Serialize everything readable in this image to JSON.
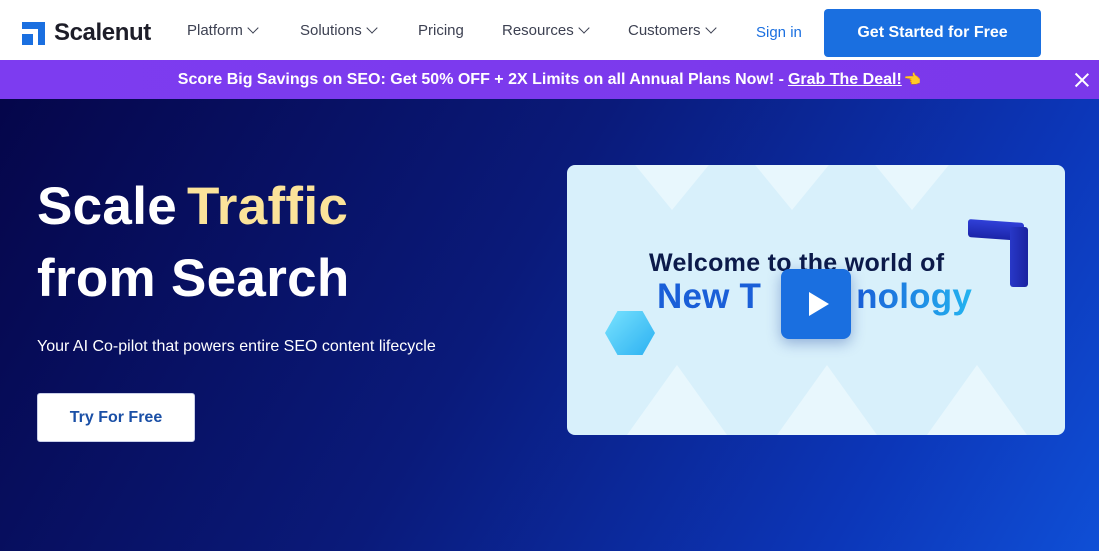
{
  "brand": {
    "name": "Scalenut",
    "color": "#1a6fe0"
  },
  "nav": {
    "items": [
      {
        "label": "Platform",
        "dropdown": true
      },
      {
        "label": "Solutions",
        "dropdown": true
      },
      {
        "label": "Pricing",
        "dropdown": false
      },
      {
        "label": "Resources",
        "dropdown": true
      },
      {
        "label": "Customers",
        "dropdown": true
      }
    ],
    "signin_label": "Sign in",
    "cta_label": "Get Started for Free"
  },
  "promo": {
    "text": "Score Big Savings on SEO: Get 50% OFF + 2X Limits on all Annual Plans Now! -",
    "link_label": "Grab The Deal!",
    "hand_icon": "👈",
    "close_icon": "close-icon",
    "background": "#7c3aed"
  },
  "hero": {
    "headline_part1": "Scale",
    "headline_highlight": "Traffic",
    "headline_line2": "from Search",
    "subtitle": "Your AI Co-pilot that powers entire SEO content lifecycle",
    "button_label": "Try For Free",
    "highlight_color": "#fbe39a"
  },
  "video": {
    "line1": "Welcome to the world of",
    "line2_a": "New T",
    "line2_b": "nology",
    "play_icon": "play-icon"
  }
}
